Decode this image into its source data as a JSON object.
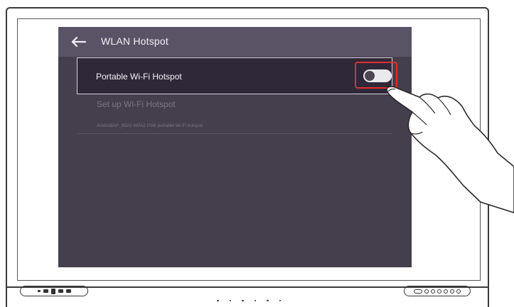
{
  "screen": {
    "title": "WLAN Hotspot",
    "back_icon": "arrow-left-icon",
    "hotspot_row": {
      "label": "Portable Wi-Fi Hotspot",
      "toggle_state": "off"
    },
    "setup_row": {
      "label": "Set up Wi-Fi Hotspot",
      "subtitle": "AndroidAP_5520 WPA2 PSK portable Wi-Fi hotspot"
    }
  },
  "colors": {
    "screen_bg": "#453f4d",
    "titlebar_bg": "#5a5365",
    "row_bg": "#2f2838",
    "highlight": "#e0302f"
  },
  "bezel": {
    "left_buttons_icon": "front-panel-buttons-icon",
    "right_ports_icon": "front-panel-ports-icon",
    "sensor_dots_icon": "sensor-dots-icon"
  },
  "overlay": {
    "hand_icon": "pointing-hand-icon"
  }
}
